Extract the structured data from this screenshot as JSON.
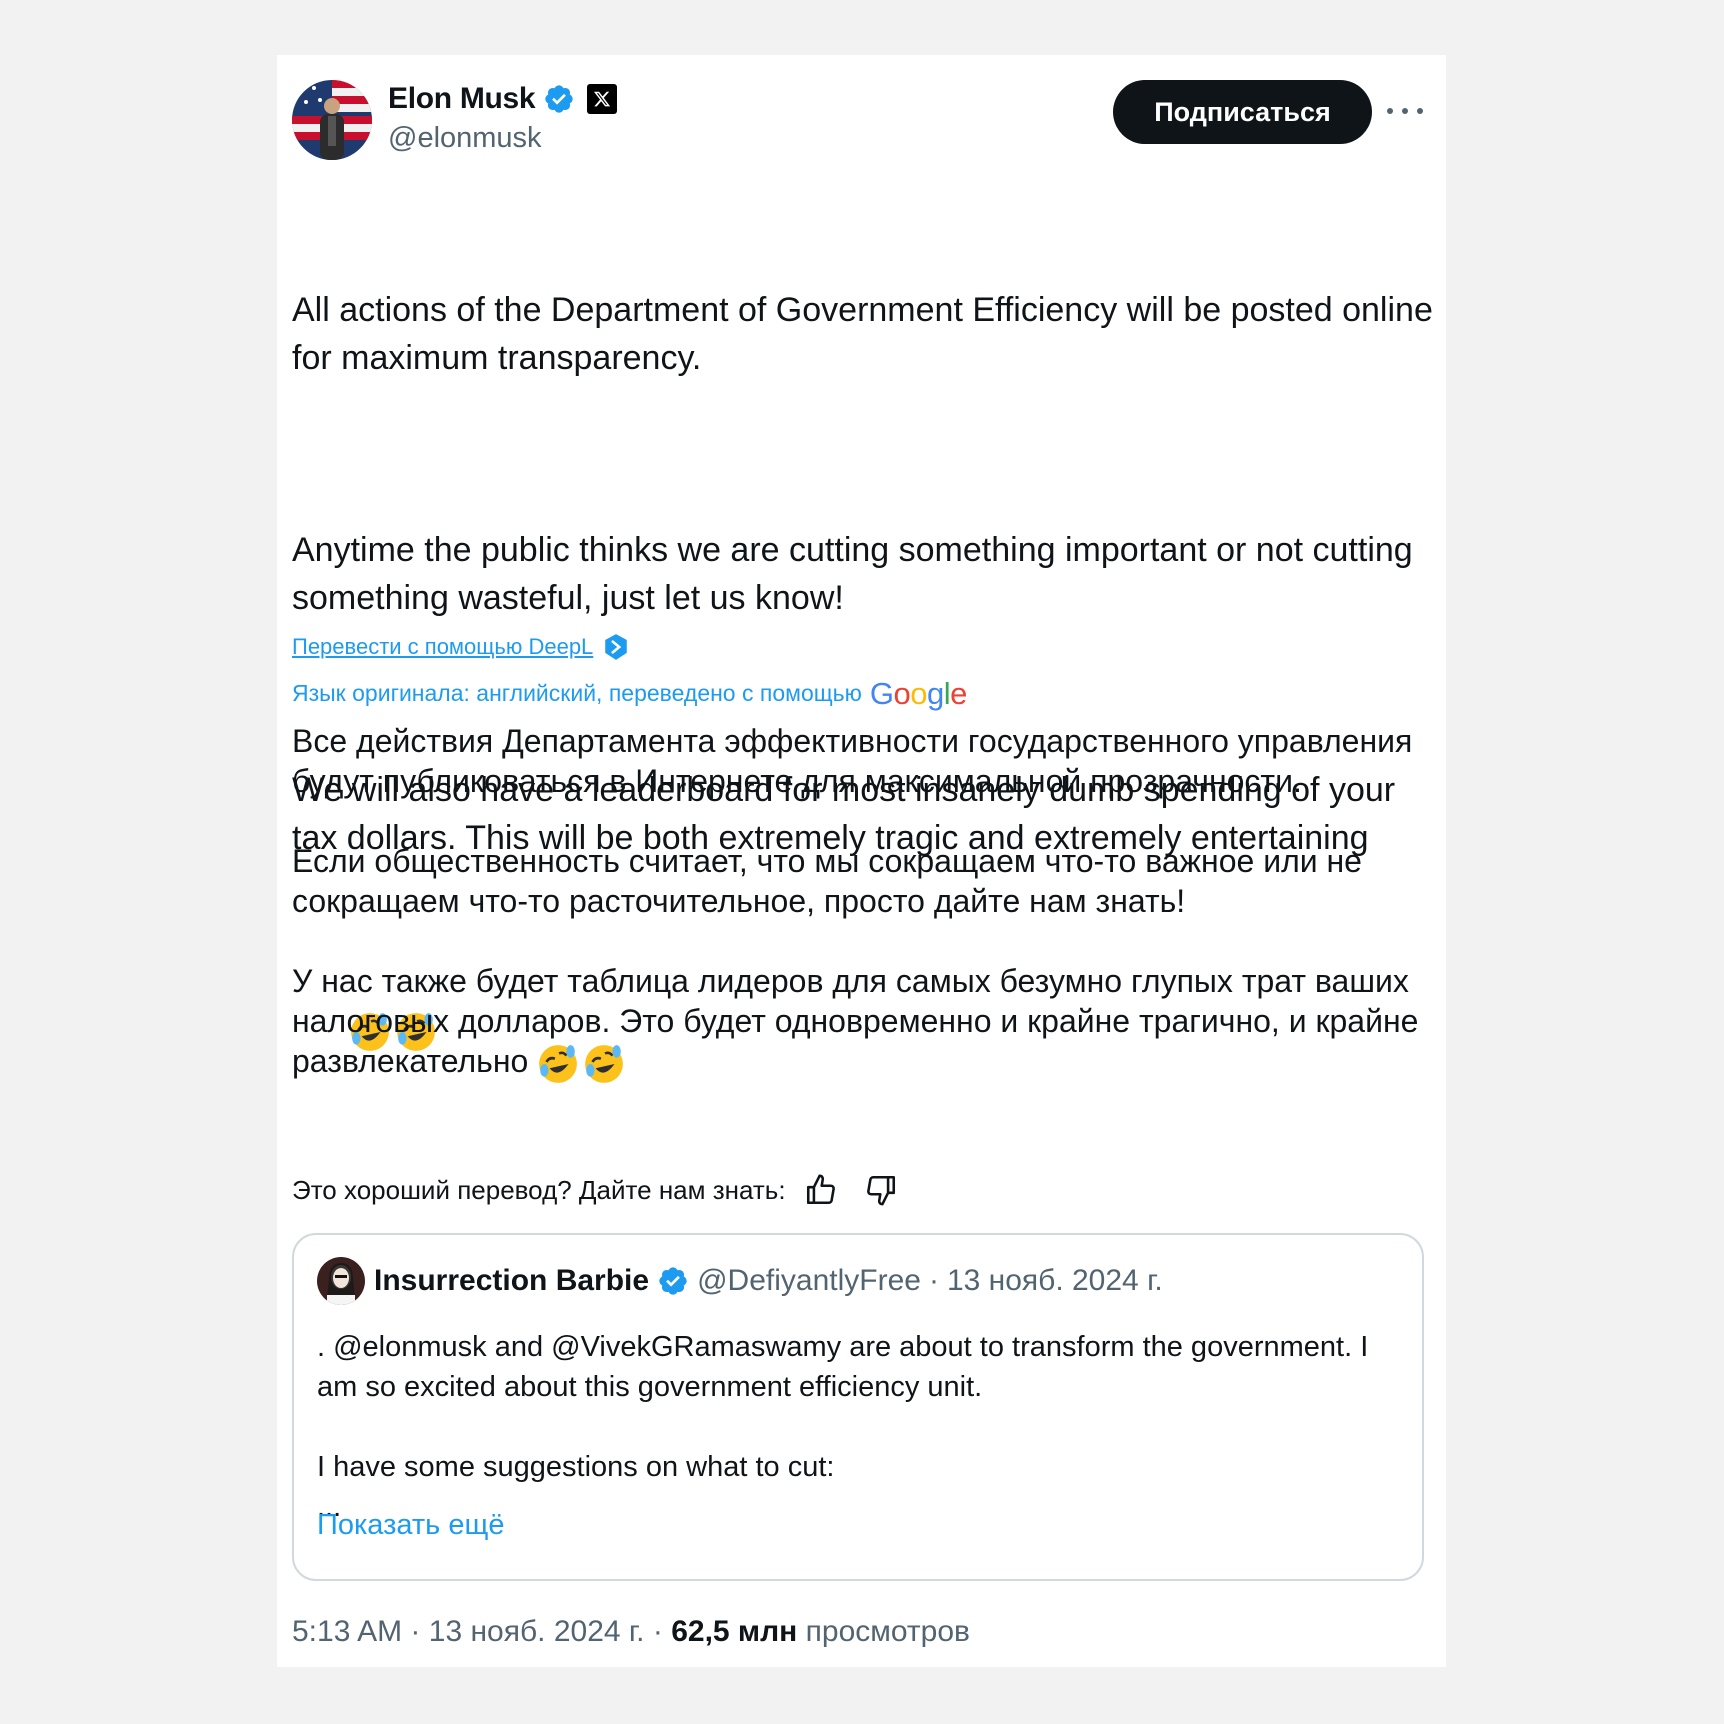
{
  "author": {
    "name": "Elon Musk",
    "handle": "@elonmusk",
    "verified_icon": "verified-badge-icon",
    "affiliation_icon": "x-logo-icon"
  },
  "header": {
    "subscribe_label": "Подписаться",
    "more_icon": "more-horizontal-icon"
  },
  "tweet": {
    "paragraphs": [
      "All actions of the Department of Government Efficiency will be posted online for maximum transparency.",
      "Anytime the public thinks we are cutting something important or not cutting something wasteful, just let us know!",
      "We will also have a leaderboard for most insanely dumb spending of your tax dollars. This will be both extremely tragic and extremely entertaining"
    ],
    "emoji": "🤣🤣"
  },
  "translate": {
    "deepl_link": "Перевести с помощью DeepL",
    "note": "Язык оригинала: английский, переведено с помощью",
    "provider_logo": "Google",
    "paragraphs": [
      "Все действия Департамента эффективности государственного управления будут публиковаться в Интернете для максимальной прозрачности.",
      "Если общественность считает, что мы сокращаем что-то важное или не сокращаем что-то расточительное, просто дайте нам знать!",
      "У нас также будет таблица лидеров для самых безумно глупых трат ваших налоговых долларов. Это будет одновременно и крайне трагично, и крайне развлекательно"
    ],
    "feedback_prompt": "Это хороший перевод? Дайте нам знать:"
  },
  "quote": {
    "name": "Insurrection Barbie",
    "handle": "@DefiyantlyFree",
    "separator": "·",
    "date": "13 нояб. 2024 г.",
    "paragraphs": [
      ". @elonmusk and @VivekGRamaswamy are about to transform the government. I am so excited about this government efficiency unit.",
      "I have some suggestions on what to cut:\n..."
    ],
    "show_more": "Показать ещё"
  },
  "footer": {
    "time": "5:13 AM",
    "sep1": "·",
    "date": "13 нояб. 2024 г.",
    "sep2": "·",
    "views_count": "62,5 млн",
    "views_label": "просмотров"
  },
  "colors": {
    "accent": "#1d9bf0",
    "text": "#0f1419",
    "muted": "#536471",
    "border": "#cfd9de",
    "background": "#f2f2f2"
  }
}
